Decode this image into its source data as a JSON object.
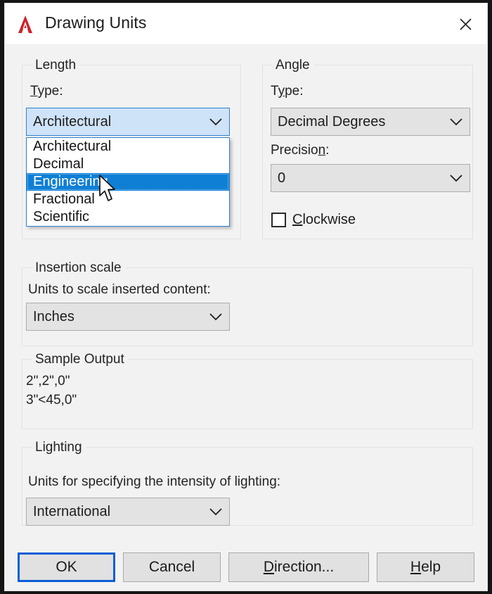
{
  "window": {
    "title": "Drawing Units",
    "logo_icon": "autocad-a-logo",
    "close_icon": "close-icon"
  },
  "length": {
    "group_label": "Length",
    "type_label_prefix": "T",
    "type_label_rest": "ype:",
    "type_value": "Architectural",
    "dropdown_open": true,
    "options": [
      "Architectural",
      "Decimal",
      "Engineering",
      "Fractional",
      "Scientific"
    ],
    "selected_option": "Engineering",
    "selected_index": 2
  },
  "angle": {
    "group_label": "Angle",
    "type_label_prefix": "T",
    "type_label_mid": "y",
    "type_label_rest": "pe:",
    "type_value": "Decimal Degrees",
    "precision_label_prefix": "Precisio",
    "precision_label_accel": "n",
    "precision_label_rest": ":",
    "precision_value": "0",
    "clockwise_accel": "C",
    "clockwise_rest": "lockwise",
    "clockwise_checked": false
  },
  "insertion_scale": {
    "group_label": "Insertion scale",
    "description": "Units to scale inserted content:",
    "value": "Inches"
  },
  "sample_output": {
    "group_label": "Sample Output",
    "line1": "2\",2\",0\"",
    "line2": "3\"<45,0\""
  },
  "lighting": {
    "group_label": "Lighting",
    "description": "Units for specifying the intensity of lighting:",
    "value": "International"
  },
  "buttons": {
    "ok": "OK",
    "cancel": "Cancel",
    "direction_accel": "D",
    "direction_rest": "irection...",
    "help_accel": "H",
    "help_rest": "elp"
  },
  "colors": {
    "highlight_blue": "#0f7fd6",
    "focus_blue": "#2f7fd1",
    "default_button_border": "#0b5ed7",
    "dialog_bg": "#f2f2f2",
    "combo_bg": "#e3e3e3",
    "logo_red": "#cc2229"
  }
}
